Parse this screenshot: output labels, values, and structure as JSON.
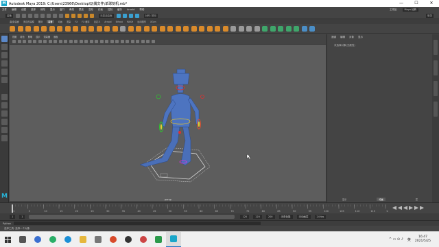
{
  "window": {
    "title": "Autodesk Maya 2019: C:\\Users\\23966\\Desktop\\玩偶文件\\单球刻机.mb*",
    "logo": "M",
    "minimize_icon": "—",
    "maximize_icon": "☐",
    "close_icon": "✕"
  },
  "menubar": {
    "items": [
      "文件",
      "编辑",
      "创建",
      "选择",
      "修改",
      "显示",
      "窗口",
      "骨架",
      "蒙皮",
      "变形",
      "约束",
      "控制",
      "缓存",
      "Arnold",
      "帮助"
    ],
    "workspace_label": "工作区:",
    "workspace_value": "Maya 经典"
  },
  "statusline": {
    "mode": "装备",
    "live_field": "无激活曲面",
    "symmetry": "对称: 禁用",
    "login": "登录"
  },
  "shelf": {
    "tabs": [
      "曲线/曲面",
      "多边形建模",
      "雕刻",
      "装备",
      "动画",
      "渲染",
      "FX",
      "FX 缓存",
      "自定义",
      "Arnold",
      "Bifrost",
      "MASH",
      "运动图形",
      "XGen"
    ],
    "active_tab": "装备"
  },
  "panel": {
    "menus": [
      "视图",
      "着色",
      "照明",
      "显示",
      "渲染器",
      "面板"
    ],
    "camera_label": "persp"
  },
  "channelbox": {
    "tabs": [
      "通道",
      "编辑",
      "对象",
      "显示"
    ],
    "empty_text": "未选择对象(无属性)",
    "bottom_tabs": [
      "显示",
      "动画",
      "层"
    ],
    "active_bottom": "动画"
  },
  "timeslider": {
    "ticks": [
      "1",
      "5",
      "10",
      "15",
      "20",
      "25",
      "30",
      "35",
      "40",
      "45",
      "50",
      "55",
      "60",
      "65",
      "70",
      "75",
      "80",
      "85",
      "90",
      "95",
      "100",
      "105",
      "110",
      "115",
      "120"
    ]
  },
  "range": {
    "start": "1",
    "start_inner": "1",
    "end_inner": "120",
    "end": "120",
    "end2": "200",
    "character_set": "无角色集",
    "anim_layer": "无动画层",
    "fps": "24 fps"
  },
  "commandline": {
    "label": "Python"
  },
  "helpline": {
    "text": "选择工具: 选择一个对象"
  },
  "taskbar": {
    "time": "16:47",
    "date": "2021/5/25",
    "lang": "英",
    "tray_icons": "^  ▭  ⊙  ♪"
  }
}
